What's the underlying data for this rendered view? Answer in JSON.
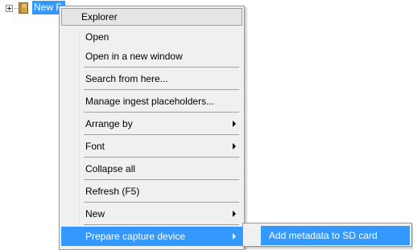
{
  "tree": {
    "node_label": "New F"
  },
  "menu": {
    "title": "Explorer",
    "items": [
      {
        "label": "Open"
      },
      {
        "label": "Open in a new window"
      },
      {
        "label": "Search from here..."
      },
      {
        "label": "Manage ingest placeholders..."
      },
      {
        "label": "Arrange by",
        "submenu": true
      },
      {
        "label": "Font",
        "submenu": true
      },
      {
        "label": "Collapse all"
      },
      {
        "label": "Refresh (F5)"
      },
      {
        "label": "New",
        "submenu": true
      },
      {
        "label": "Prepare capture device",
        "submenu": true,
        "highlighted": true
      }
    ]
  },
  "submenu": {
    "items": [
      {
        "label": "Add metadata to SD card",
        "highlighted": true
      }
    ]
  },
  "colors": {
    "selection": "#3399ff",
    "menu_background": "#f0f0f0"
  },
  "icons": {
    "expander": "expand-plus-icon",
    "node": "book-icon",
    "submenu_arrow": "submenu-arrow-icon"
  }
}
